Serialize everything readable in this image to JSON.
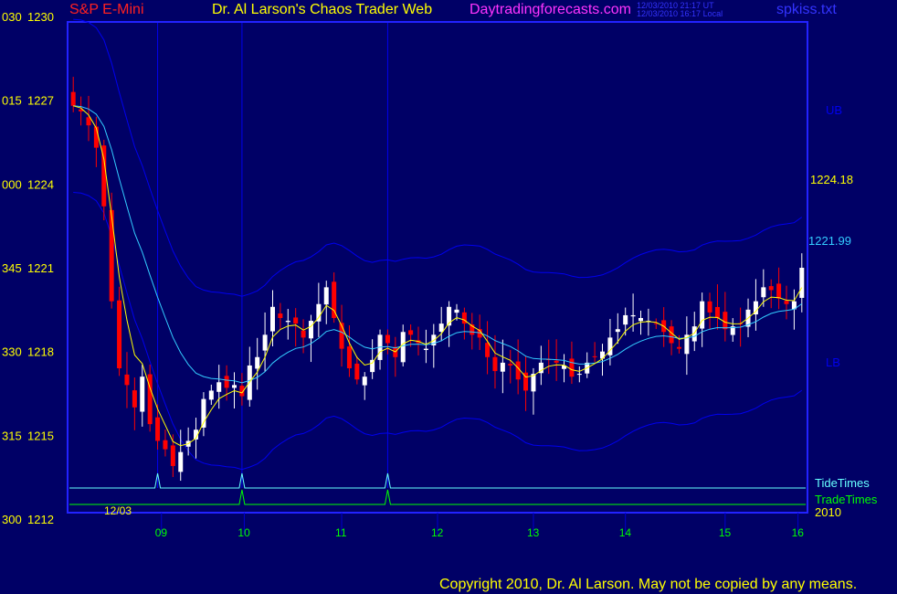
{
  "header": {
    "symbol": "S&P E-Mini",
    "title": "Dr. Al Larson's Chaos Trader Web",
    "site": "Daytradingforecasts.com",
    "stamp_ut": "12/03/2010 21:17 UT",
    "stamp_local": "12/03/2010 16:17 Local",
    "file": "spkiss.txt"
  },
  "footer": {
    "copyright": "Copyright 2010, Dr. Al Larson. May not be copied by any means."
  },
  "colors": {
    "background": "#000066",
    "frame": "#2222ff",
    "up_candle": "#ffffff",
    "down_candle": "#ff0000",
    "ema_fast": "#ffff00",
    "ema_mid": "#33ccff",
    "band": "#0000ee",
    "tide_times": "#66ffff",
    "trade_times": "#00ff00",
    "symbol_text": "#ff2020",
    "title_text": "#ffff00",
    "site_text": "#ff33ff",
    "stamp_text": "#3333ff",
    "file_text": "#3333ff",
    "time_labels": "#00ff00",
    "price_labels": "#ffff00",
    "copyright_text": "#ffff00"
  },
  "chart_data": {
    "type": "candlestick",
    "title": "S&P E-Mini",
    "y_tick_labels": [
      {
        "time": "030",
        "price": "1230",
        "value": 1230
      },
      {
        "time": "015",
        "price": "1227",
        "value": 1227
      },
      {
        "time": "000",
        "price": "1224",
        "value": 1224
      },
      {
        "time": "345",
        "price": "1221",
        "value": 1221
      },
      {
        "time": "330",
        "price": "1218",
        "value": 1218
      },
      {
        "time": "315",
        "price": "1215",
        "value": 1215
      },
      {
        "time": "300",
        "price": "1212",
        "value": 1212
      }
    ],
    "ylim": [
      1212,
      1230
    ],
    "x_ticks": [
      "09",
      "10",
      "11",
      "12",
      "13",
      "14",
      "15",
      "16"
    ],
    "date_label": "12/03",
    "year_label": "2010",
    "bar_count": 96,
    "price_value_labels": [
      {
        "text": "1224.18",
        "value": 1224.18,
        "kind": "ema_fast"
      },
      {
        "text": "1221.99",
        "value": 1221.99,
        "kind": "ema_mid"
      }
    ],
    "band_labels": [
      "UB",
      "LB"
    ],
    "timing_lines": [
      {
        "name": "TideTimes",
        "spike_bars": [
          11,
          22,
          41
        ]
      },
      {
        "name": "TradeTimes",
        "spike_bars": [
          22,
          41
        ]
      }
    ],
    "vertical_markers_bars": [
      11,
      22,
      41
    ],
    "closes": [
      1227.3,
      1226.8,
      1226.6,
      1226.1,
      1225.3,
      1223.2,
      1219.8,
      1217.4,
      1216.8,
      1216.0,
      1217.1,
      1215.4,
      1214.8,
      1214.5,
      1213.9,
      1214.4,
      1214.8,
      1215.2,
      1216.3,
      1216.6,
      1216.9,
      1216.7,
      1216.8,
      1216.4,
      1217.5,
      1217.8,
      1218.6,
      1219.6,
      1219.2,
      1219.1,
      1219.0,
      1218.5,
      1219.1,
      1219.7,
      1220.3,
      1219.2,
      1218.1,
      1217.4,
      1217.0,
      1217.1,
      1217.7,
      1218.6,
      1218.3,
      1217.8,
      1218.7,
      1218.6,
      1218.3,
      1218.1,
      1218.6,
      1219.0,
      1219.6,
      1219.5,
      1219.0,
      1218.6,
      1218.5,
      1217.8,
      1217.3,
      1217.6,
      1217.5,
      1217.0,
      1216.6,
      1217.2,
      1217.6,
      1217.7,
      1217.6,
      1217.5,
      1217.1,
      1217.2,
      1217.6,
      1217.8,
      1218.0,
      1218.5,
      1218.8,
      1219.3,
      1219.3,
      1219.2,
      1219.1,
      1219.0,
      1218.7,
      1218.3,
      1218.1,
      1218.6,
      1218.9,
      1219.8,
      1219.4,
      1219.2,
      1218.8,
      1218.9,
      1219.0,
      1219.5,
      1219.8,
      1220.3,
      1220.2,
      1219.9,
      1219.7,
      1219.8,
      1221.0,
      1222.6,
      1223.6,
      1224.1,
      1224.6,
      1224.3,
      1224.18
    ]
  }
}
